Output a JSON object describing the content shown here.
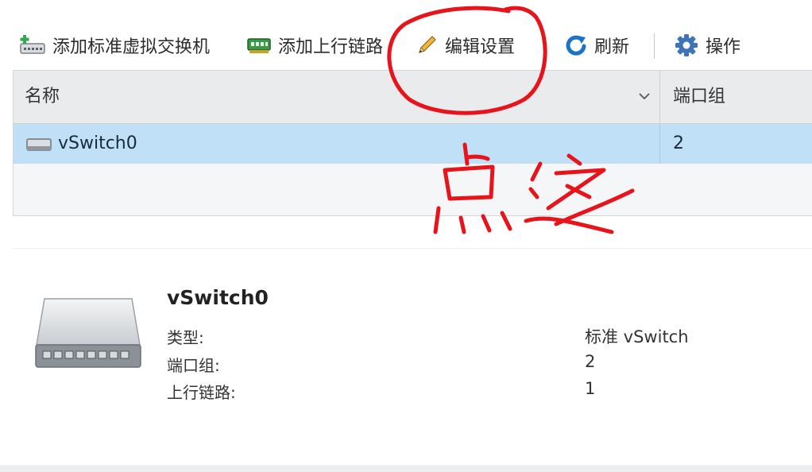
{
  "toolbar": {
    "add_vswitch": "添加标准虚拟交换机",
    "add_uplink": "添加上行链路",
    "edit_settings": "编辑设置",
    "refresh": "刷新",
    "actions": "操作"
  },
  "grid": {
    "headers": {
      "name": "名称",
      "port_groups": "端口组"
    },
    "rows": [
      {
        "name": "vSwitch0",
        "port_groups": "2"
      }
    ]
  },
  "details": {
    "title": "vSwitch0",
    "fields": [
      {
        "label": "类型:",
        "value": "标准 vSwitch"
      },
      {
        "label": "端口组:",
        "value": "2"
      },
      {
        "label": "上行链路:",
        "value": "1"
      }
    ]
  },
  "annotation": {
    "handwriting": "点这",
    "color": "#e8141c"
  },
  "colors": {
    "selected_row": "#bfe0f6",
    "header_bg": "#e9ebed",
    "accent_blue": "#1a73c8"
  },
  "icons": [
    "add-switch-icon",
    "add-uplink-icon",
    "pencil-icon",
    "refresh-icon",
    "gear-icon",
    "chevron-down-icon",
    "switch-icon"
  ]
}
